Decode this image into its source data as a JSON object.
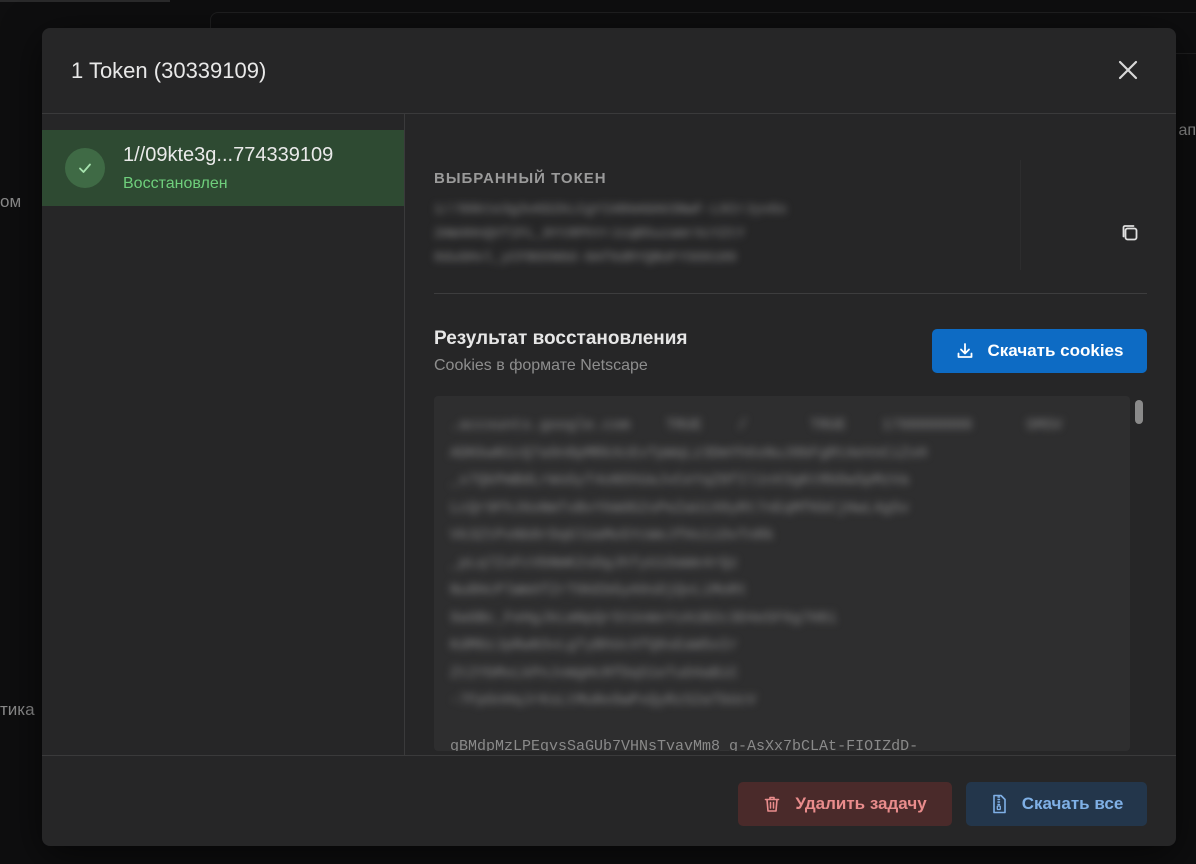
{
  "background": {
    "text_left_top": "ом",
    "text_left_bottom": "тика",
    "text_right": "ап"
  },
  "modal": {
    "title": "1 Token (30339109)",
    "close_icon": "close-icon"
  },
  "sidebar": {
    "items": [
      {
        "name": "1//09kte3g...774339109",
        "status": "Восстановлен",
        "icon": "check-icon"
      }
    ]
  },
  "selected_token": {
    "label": "ВЫБРАННЫЙ ТОКЕН",
    "value_blurred": "1//09kte3g3vKD2kLCgYIARAAGAkSNwF-L9IrJyvGs\n2mW4HnQVTIFL_0YtRPhYrJzqB5uzamrXcYZtY\n8duGHvl_yCFBG5N8d-0Af6dRYQBUFYSG9109",
    "copy_icon": "copy-icon"
  },
  "result": {
    "title": "Результат восстановления",
    "subtitle": "Cookies в формате Netscape",
    "download_cookies_label": "Скачать cookies",
    "download_icon": "download-icon",
    "cookies_blurred": ".accounts.google.com\tTRUE\t/\tTRUE\t1788888888\tSMSV\nADKkwN1cQ7a9n8pMRkXcEvTpWqLz3DmYh6sNuJ0bFgRtAeVoCiZxH\n_x7QkPmBdLrWsGyT4oN5hUaJvCeYqZ8fIl1nX3gKtRbDwSpMzVa\nLcQr9FhJ6oNmTxBvYkWdG2sPeZaUiX0yRt7nEqMfKbCjHwL4gSv\nVk3ZtPxNb8rDqGlUaMo5YcWeJfHs1iOvTnRk\n_pLq7ZxFcVbNmK2sDgJhTyUiOaWe4rQz\nNu8HcPlWmXfZrT0kEbGyA9sDjQvLiMoRt\n9a6Bc_FeHgJkLmNpQrStUvWxYzA1B2c3D4e5F6g7H8i\nKdM0zJpRwN3vLgTyBhUcXfQ8sEaW5oIr\nZt2YbMxLkPnJvWgHcRfDqS1eTuO4aBiC\n-7FpGnHqJrKsLtMuNvOwPxQyRzS2aTbUcV",
    "cookies_last_line": "gBMdpMzLPEqvsSaGUb7VHNsTvavMm8_g-AsXx7bCLAt-FIOIZdD-"
  },
  "footer": {
    "delete_label": "Удалить задачу",
    "delete_icon": "trash-icon",
    "download_all_label": "Скачать все",
    "download_all_icon": "zip-file-icon"
  },
  "colors": {
    "accent": "#0d6bc4",
    "success": "#6fcf7c",
    "danger_text": "#e98c8c",
    "secondary_text": "#7fb0e6"
  }
}
